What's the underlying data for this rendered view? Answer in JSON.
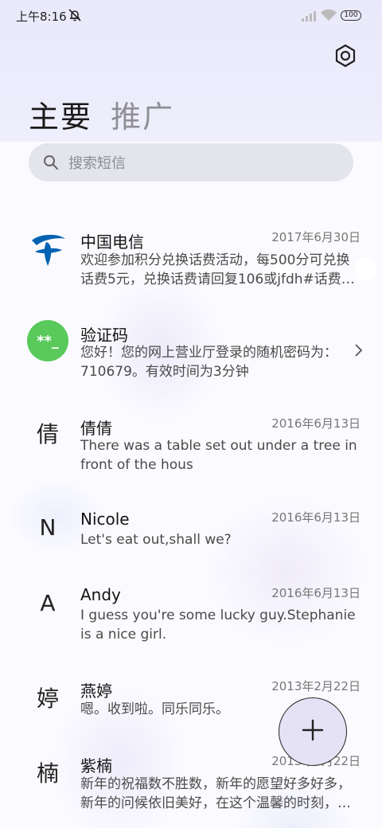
{
  "status_bar": {
    "time": "上午8:16",
    "battery": "100"
  },
  "header": {
    "tabs": [
      {
        "label": "主要",
        "active": true
      },
      {
        "label": "推广",
        "active": false
      }
    ]
  },
  "search": {
    "placeholder": "搜索短信",
    "value": ""
  },
  "colors": {
    "telecom_blue": "#0062b1",
    "verify_green": "#58c95a",
    "fab_bg": "#e5e2f5"
  },
  "conversations": [
    {
      "avatar_icon": "china-telecom-logo-icon",
      "name": "中国电信",
      "date": "2017年6月30日",
      "preview": "欢迎参加积分兑换话费活动，每500分可兑换话费5元，兑换话费请回复106或jfdh#话费…"
    },
    {
      "avatar_text": "**_",
      "name": "验证码",
      "date": "",
      "preview": "您好！您的网上营业厅登录的随机密码为：710679。有效时间为3分钟"
    },
    {
      "avatar_text": "倩",
      "name": "倩倩",
      "date": "2016年6月13日",
      "preview": "There was a table set out under a tree in front of the hous"
    },
    {
      "avatar_text": "N",
      "name": "Nicole",
      "date": "2016年6月13日",
      "preview": "Let's eat out,shall we?"
    },
    {
      "avatar_text": "A",
      "name": "Andy",
      "date": "2016年6月13日",
      "preview": "I guess you're some lucky guy.Stephanie is a nice girl."
    },
    {
      "avatar_text": "婷",
      "name": "燕婷",
      "date": "2013年2月22日",
      "preview": "嗯。收到啦。同乐同乐。"
    },
    {
      "avatar_text": "楠",
      "name": "紫楠",
      "date": "2013年2月22日",
      "preview": "新年的祝福数不胜数，新年的愿望好多好多，新年的问候依旧美好，在这个温馨的时刻，…"
    }
  ]
}
